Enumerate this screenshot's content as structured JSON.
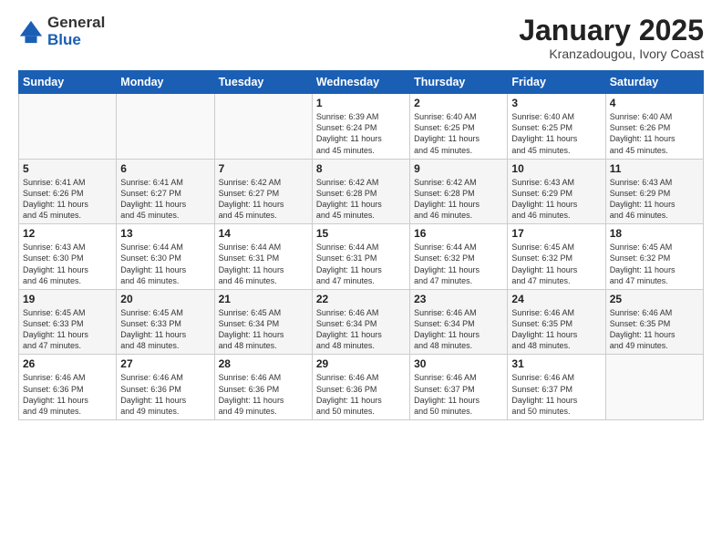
{
  "logo": {
    "general": "General",
    "blue": "Blue"
  },
  "header": {
    "title": "January 2025",
    "subtitle": "Kranzadougou, Ivory Coast"
  },
  "weekdays": [
    "Sunday",
    "Monday",
    "Tuesday",
    "Wednesday",
    "Thursday",
    "Friday",
    "Saturday"
  ],
  "weeks": [
    [
      {
        "day": "",
        "info": ""
      },
      {
        "day": "",
        "info": ""
      },
      {
        "day": "",
        "info": ""
      },
      {
        "day": "1",
        "info": "Sunrise: 6:39 AM\nSunset: 6:24 PM\nDaylight: 11 hours\nand 45 minutes."
      },
      {
        "day": "2",
        "info": "Sunrise: 6:40 AM\nSunset: 6:25 PM\nDaylight: 11 hours\nand 45 minutes."
      },
      {
        "day": "3",
        "info": "Sunrise: 6:40 AM\nSunset: 6:25 PM\nDaylight: 11 hours\nand 45 minutes."
      },
      {
        "day": "4",
        "info": "Sunrise: 6:40 AM\nSunset: 6:26 PM\nDaylight: 11 hours\nand 45 minutes."
      }
    ],
    [
      {
        "day": "5",
        "info": "Sunrise: 6:41 AM\nSunset: 6:26 PM\nDaylight: 11 hours\nand 45 minutes."
      },
      {
        "day": "6",
        "info": "Sunrise: 6:41 AM\nSunset: 6:27 PM\nDaylight: 11 hours\nand 45 minutes."
      },
      {
        "day": "7",
        "info": "Sunrise: 6:42 AM\nSunset: 6:27 PM\nDaylight: 11 hours\nand 45 minutes."
      },
      {
        "day": "8",
        "info": "Sunrise: 6:42 AM\nSunset: 6:28 PM\nDaylight: 11 hours\nand 45 minutes."
      },
      {
        "day": "9",
        "info": "Sunrise: 6:42 AM\nSunset: 6:28 PM\nDaylight: 11 hours\nand 46 minutes."
      },
      {
        "day": "10",
        "info": "Sunrise: 6:43 AM\nSunset: 6:29 PM\nDaylight: 11 hours\nand 46 minutes."
      },
      {
        "day": "11",
        "info": "Sunrise: 6:43 AM\nSunset: 6:29 PM\nDaylight: 11 hours\nand 46 minutes."
      }
    ],
    [
      {
        "day": "12",
        "info": "Sunrise: 6:43 AM\nSunset: 6:30 PM\nDaylight: 11 hours\nand 46 minutes."
      },
      {
        "day": "13",
        "info": "Sunrise: 6:44 AM\nSunset: 6:30 PM\nDaylight: 11 hours\nand 46 minutes."
      },
      {
        "day": "14",
        "info": "Sunrise: 6:44 AM\nSunset: 6:31 PM\nDaylight: 11 hours\nand 46 minutes."
      },
      {
        "day": "15",
        "info": "Sunrise: 6:44 AM\nSunset: 6:31 PM\nDaylight: 11 hours\nand 47 minutes."
      },
      {
        "day": "16",
        "info": "Sunrise: 6:44 AM\nSunset: 6:32 PM\nDaylight: 11 hours\nand 47 minutes."
      },
      {
        "day": "17",
        "info": "Sunrise: 6:45 AM\nSunset: 6:32 PM\nDaylight: 11 hours\nand 47 minutes."
      },
      {
        "day": "18",
        "info": "Sunrise: 6:45 AM\nSunset: 6:32 PM\nDaylight: 11 hours\nand 47 minutes."
      }
    ],
    [
      {
        "day": "19",
        "info": "Sunrise: 6:45 AM\nSunset: 6:33 PM\nDaylight: 11 hours\nand 47 minutes."
      },
      {
        "day": "20",
        "info": "Sunrise: 6:45 AM\nSunset: 6:33 PM\nDaylight: 11 hours\nand 48 minutes."
      },
      {
        "day": "21",
        "info": "Sunrise: 6:45 AM\nSunset: 6:34 PM\nDaylight: 11 hours\nand 48 minutes."
      },
      {
        "day": "22",
        "info": "Sunrise: 6:46 AM\nSunset: 6:34 PM\nDaylight: 11 hours\nand 48 minutes."
      },
      {
        "day": "23",
        "info": "Sunrise: 6:46 AM\nSunset: 6:34 PM\nDaylight: 11 hours\nand 48 minutes."
      },
      {
        "day": "24",
        "info": "Sunrise: 6:46 AM\nSunset: 6:35 PM\nDaylight: 11 hours\nand 48 minutes."
      },
      {
        "day": "25",
        "info": "Sunrise: 6:46 AM\nSunset: 6:35 PM\nDaylight: 11 hours\nand 49 minutes."
      }
    ],
    [
      {
        "day": "26",
        "info": "Sunrise: 6:46 AM\nSunset: 6:36 PM\nDaylight: 11 hours\nand 49 minutes."
      },
      {
        "day": "27",
        "info": "Sunrise: 6:46 AM\nSunset: 6:36 PM\nDaylight: 11 hours\nand 49 minutes."
      },
      {
        "day": "28",
        "info": "Sunrise: 6:46 AM\nSunset: 6:36 PM\nDaylight: 11 hours\nand 49 minutes."
      },
      {
        "day": "29",
        "info": "Sunrise: 6:46 AM\nSunset: 6:36 PM\nDaylight: 11 hours\nand 50 minutes."
      },
      {
        "day": "30",
        "info": "Sunrise: 6:46 AM\nSunset: 6:37 PM\nDaylight: 11 hours\nand 50 minutes."
      },
      {
        "day": "31",
        "info": "Sunrise: 6:46 AM\nSunset: 6:37 PM\nDaylight: 11 hours\nand 50 minutes."
      },
      {
        "day": "",
        "info": ""
      }
    ]
  ]
}
